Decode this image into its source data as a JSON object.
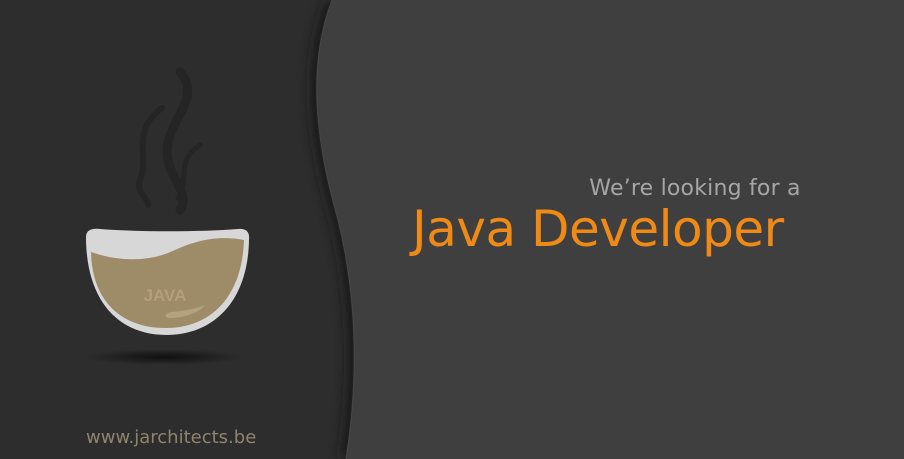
{
  "banner": {
    "subtitle": "We’re looking for a",
    "headline": "Java Developer",
    "website": "www.jarchitects.be",
    "cup_label": "JAVA"
  },
  "colors": {
    "left_panel": "#2d2d2d",
    "right_panel": "#3f3f3f",
    "headline": "#f08a16",
    "subtitle": "#a6a6a6",
    "website": "#8f8470",
    "coffee": "#9e8b67",
    "cup": "#d8d8d8"
  },
  "icons": {
    "illustration": "java-coffee-cup-icon",
    "steam": "steam-icon"
  }
}
